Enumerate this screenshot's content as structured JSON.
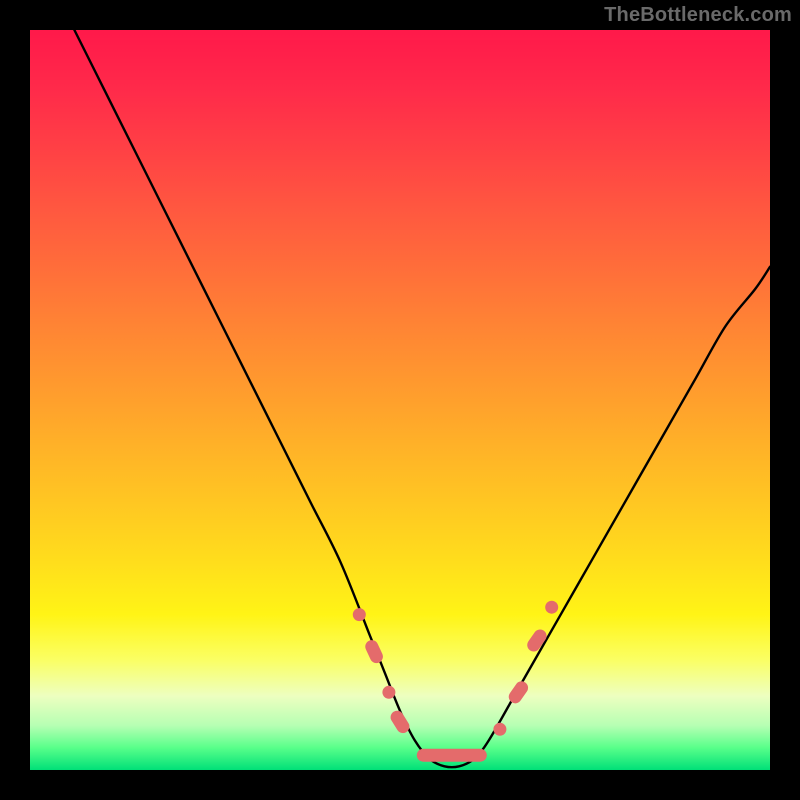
{
  "watermark": "TheBottleneck.com",
  "colors": {
    "frame": "#000000",
    "curve": "#000000",
    "marker_fill": "#e46b6b",
    "marker_stroke": "#d24f4f"
  },
  "chart_data": {
    "type": "line",
    "title": "",
    "xlabel": "",
    "ylabel": "",
    "xlim": [
      0,
      100
    ],
    "ylim": [
      0,
      100
    ],
    "grid": false,
    "series": [
      {
        "name": "bottleneck-curve",
        "x": [
          6,
          10,
          14,
          18,
          22,
          26,
          30,
          34,
          38,
          42,
          46,
          48,
          50,
          52,
          54,
          56,
          58,
          60,
          62,
          66,
          70,
          74,
          78,
          82,
          86,
          90,
          94,
          98,
          100
        ],
        "values": [
          100,
          92,
          84,
          76,
          68,
          60,
          52,
          44,
          36,
          28,
          18,
          13,
          8,
          4,
          1.5,
          0.5,
          0.5,
          1.5,
          4,
          11,
          18,
          25,
          32,
          39,
          46,
          53,
          60,
          65,
          68
        ]
      }
    ],
    "markers": [
      {
        "kind": "dot",
        "x": 44.5,
        "y": 21
      },
      {
        "kind": "pill",
        "x": 46.5,
        "y": 16,
        "angle": 65
      },
      {
        "kind": "dot",
        "x": 48.5,
        "y": 10.5
      },
      {
        "kind": "pill",
        "x": 50.0,
        "y": 6.5,
        "angle": 58
      },
      {
        "kind": "pill",
        "x": 57.0,
        "y": 2.0,
        "angle": 0,
        "long": true
      },
      {
        "kind": "dot",
        "x": 63.5,
        "y": 5.5
      },
      {
        "kind": "pill",
        "x": 66.0,
        "y": 10.5,
        "angle": -55
      },
      {
        "kind": "pill",
        "x": 68.5,
        "y": 17.5,
        "angle": -55
      },
      {
        "kind": "dot",
        "x": 70.5,
        "y": 22
      }
    ]
  }
}
